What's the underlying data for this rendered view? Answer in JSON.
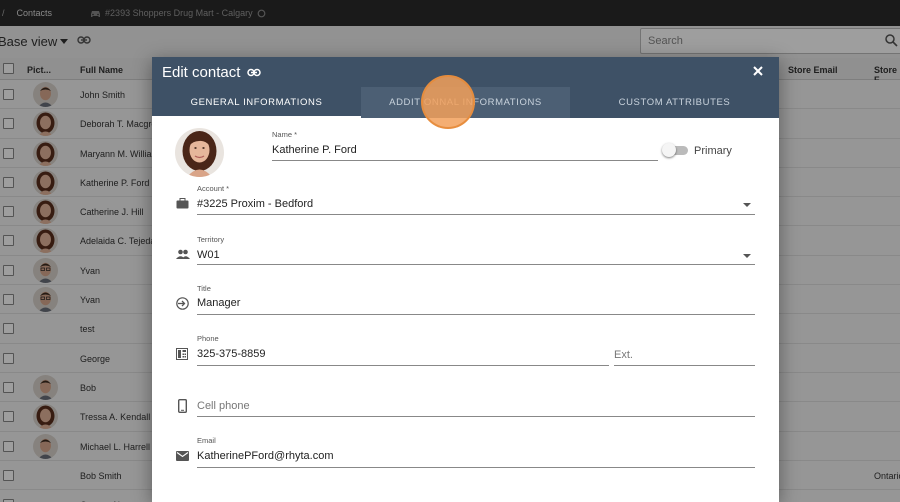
{
  "topbar": {
    "slash": "/",
    "crumb": "Contacts",
    "store": "#2393 Shoppers Drug Mart - Calgary"
  },
  "toolbar": {
    "view_title": "Base view",
    "search_placeholder": "Search"
  },
  "grid": {
    "columns": {
      "picture": "Pict...",
      "full_name": "Full Name",
      "store_email": "Store Email",
      "store": "Store F"
    },
    "rows": [
      {
        "name": "John Smith",
        "photo": "man",
        "right": ""
      },
      {
        "name": "Deborah T. Macgre",
        "photo": "woman",
        "right": ""
      },
      {
        "name": "Maryann M. Willian",
        "photo": "woman",
        "right": ""
      },
      {
        "name": "Katherine P. Ford",
        "photo": "woman",
        "right": ""
      },
      {
        "name": "Catherine J. Hill",
        "photo": "woman",
        "right": ""
      },
      {
        "name": "Adelaida C. Tejeda",
        "photo": "woman",
        "right": ""
      },
      {
        "name": "Yvan",
        "photo": "man-glasses",
        "right": ""
      },
      {
        "name": "Yvan",
        "photo": "man-glasses",
        "right": ""
      },
      {
        "name": "test",
        "photo": "",
        "right": ""
      },
      {
        "name": "George",
        "photo": "",
        "right": ""
      },
      {
        "name": "Bob",
        "photo": "man",
        "right": ""
      },
      {
        "name": "Tressa A. Kendall",
        "photo": "woman",
        "right": ""
      },
      {
        "name": "Michael L. Harrell",
        "photo": "man",
        "right": ""
      },
      {
        "name": "Bob Smith",
        "photo": "",
        "right": "Ontario"
      },
      {
        "name": "Contact Name",
        "photo": "",
        "right": ""
      }
    ]
  },
  "dialog": {
    "title": "Edit contact",
    "tabs": [
      {
        "label": "GENERAL INFORMATIONS",
        "active": true
      },
      {
        "label": "ADDITIONNAL INFORMATIONS",
        "active": false
      },
      {
        "label": "CUSTOM ATTRIBUTES",
        "active": false
      }
    ],
    "name": {
      "label": "Name *",
      "value": "Katherine P. Ford"
    },
    "primary": {
      "label": "Primary",
      "checked": false
    },
    "account": {
      "label": "Account *",
      "value": "#3225 Proxim - Bedford"
    },
    "territory": {
      "label": "Territory",
      "value": "W01"
    },
    "job_title": {
      "label": "Title",
      "value": "Manager"
    },
    "phone": {
      "label": "Phone",
      "value": "325-375-8859",
      "ext_placeholder": "Ext."
    },
    "cell_phone": {
      "placeholder": "Cell phone"
    },
    "email": {
      "label": "Email",
      "value": "KatherinePFord@rhyta.com"
    }
  },
  "colors": {
    "header": "#3e5166",
    "ripple": "#f2a05a",
    "topbar": "#2b2b2b"
  }
}
